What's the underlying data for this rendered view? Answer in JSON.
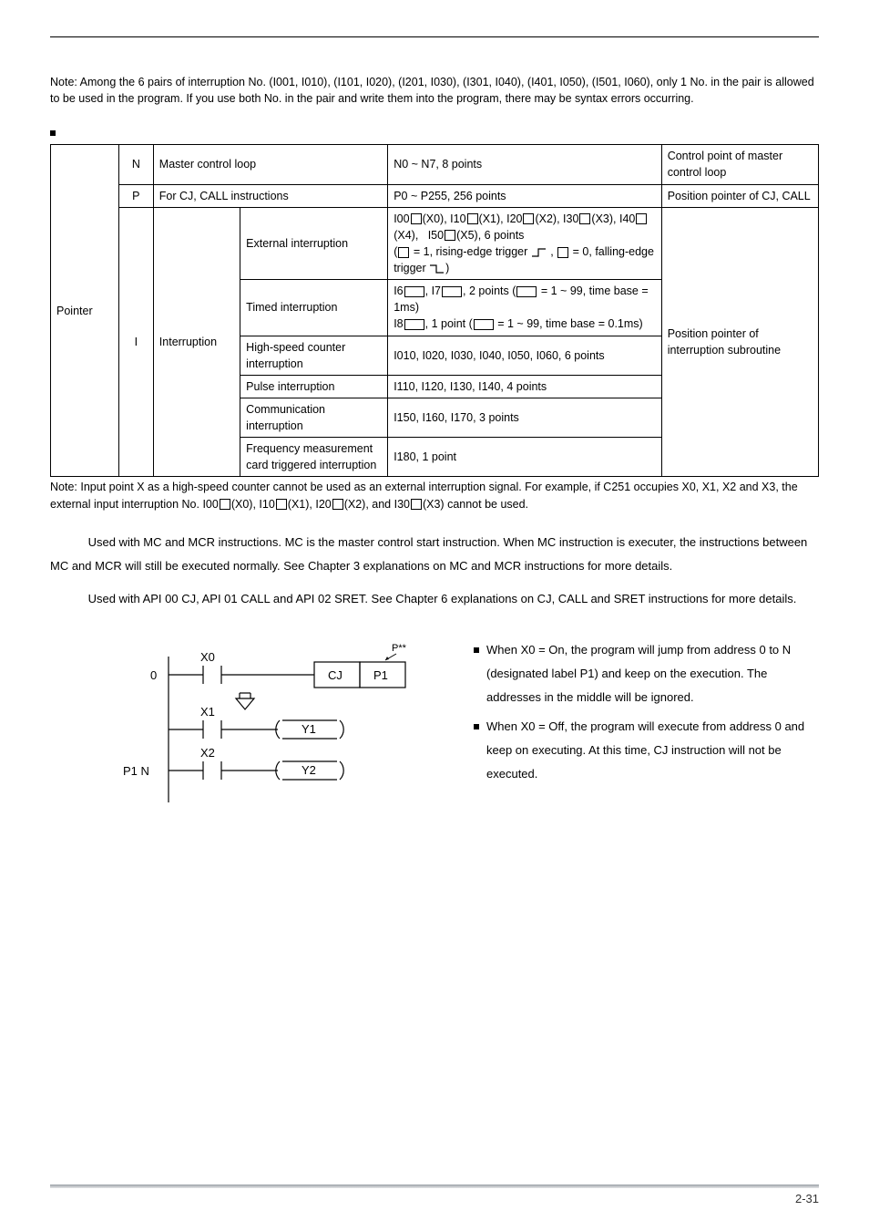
{
  "topNote": "Note: Among the 6 pairs of interruption No. (I001, I010), (I101, I020), (I201, I030), (I301, I040), (I401, I050), (I501, I060), only 1 No. in the pair is allowed to be used in the program. If you use both No. in the pair and write them into the program, there may be syntax errors occurring.",
  "table": {
    "leftHeader": "Pointer",
    "rowN": {
      "code": "N",
      "col2": "Master control loop",
      "col3": "N0 ~ N7, 8 points",
      "col4": "Control point of master control loop"
    },
    "rowP": {
      "code": "P",
      "col2": "For CJ, CALL instructions",
      "col3": "P0 ~ P255, 256 points",
      "col4": "Position pointer of CJ, CALL"
    },
    "rowI": {
      "code": "I",
      "col2": "Interruption",
      "col4": "Position pointer of interruption subroutine",
      "sub": [
        {
          "label": "External interruption",
          "desc_plain": "I00□(X0), I10□(X1), I20□(X2), I30□(X3), I40□(X4),   I50□(X5), 6 points\n(□ = 1, rising-edge trigger ⬏ , □ = 0, falling-edge trigger ⬎)"
        },
        {
          "label": "Timed interruption",
          "desc_plain": "I6□□, I7□□, 2 points (□□ = 1 ~ 99, time base = 1ms)\nI8□□, 1 point (□□ = 1 ~ 99, time base = 0.1ms)"
        },
        {
          "label": "High-speed counter interruption",
          "desc": "I010, I020, I030, I040, I050, I060, 6 points"
        },
        {
          "label": "Pulse interruption",
          "desc": "I110, I120, I130, I140, 4 points"
        },
        {
          "label": "Communication interruption",
          "desc": "I150, I160, I170, 3 points"
        },
        {
          "label": "Frequency measurement card triggered interruption",
          "desc": "I180, 1 point"
        }
      ]
    }
  },
  "bottomNote": "Note: Input point X as a high-speed counter cannot be used as an external interruption signal. For example, if C251 occupies X0, X1, X2 and X3, the external input interruption No. I00□(X0), I10□(X1), I20□(X2), and I30□(X3) cannot be used.",
  "para1": "Used with MC and MCR instructions. MC is the master control start instruction. When MC instruction is executer, the instructions between MC and MCR will still be executed normally. See Chapter 3 explanations on MC and MCR instructions for more details.",
  "para2": "Used with API 00 CJ, API 01 CALL and API 02 SRET. See Chapter 6 explanations on CJ, CALL and SRET instructions for more details.",
  "ladder": {
    "zero": "0",
    "p1n": "P1  N",
    "x0": "X0",
    "x1": "X1",
    "x2": "X2",
    "cj": "CJ",
    "p1": "P1",
    "y1": "Y1",
    "y2": "Y2",
    "pstar": "P**"
  },
  "rhs1": "When X0 = On, the program will jump from address 0 to N (designated label P1) and keep on the execution. The addresses in the middle will be ignored.",
  "rhs2": "When X0 = Off, the program will execute from address 0 and keep on executing. At this time, CJ instruction will not be executed.",
  "pageNum": "2-31"
}
